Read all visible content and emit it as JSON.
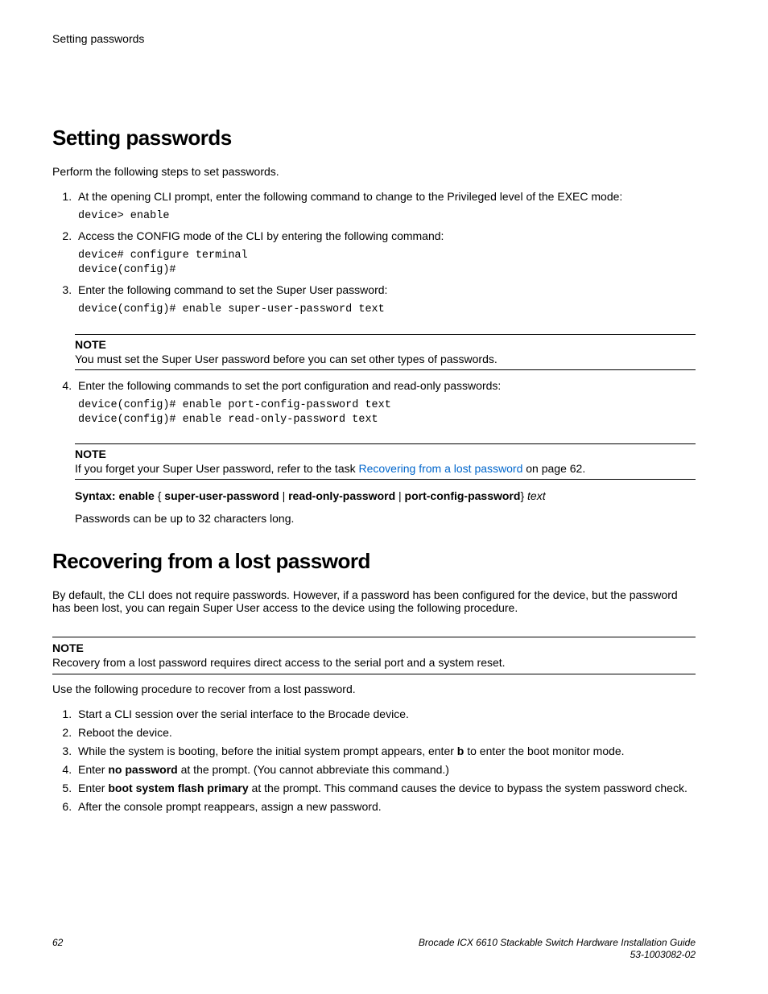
{
  "header_label": "Setting passwords",
  "section1": {
    "title": "Setting passwords",
    "intro": "Perform the following steps to set passwords.",
    "step1": "At the opening CLI prompt, enter the following command to change to the Privileged level of the EXEC mode:",
    "code1": "device> enable",
    "step2": "Access the CONFIG mode of the CLI by entering the following command:",
    "code2": "device# configure terminal\ndevice(config)#",
    "step3": "Enter the following command to set the Super User password:",
    "code3": "device(config)# enable super-user-password text",
    "note1_label": "NOTE",
    "note1_text": "You must set the Super User password before you can set other types of passwords.",
    "step4": "Enter the following commands to set the port configuration and read-only passwords:",
    "code4": "device(config)# enable port-config-password text\ndevice(config)# enable read-only-password text",
    "note2_label": "NOTE",
    "note2_prefix": "If you forget your Super User password, refer to the task ",
    "note2_link": "Recovering from a lost password",
    "note2_suffix": " on page 62.",
    "syntax_prefix": "Syntax: enable",
    "syntax_opt1": "super-user-password",
    "syntax_opt2": "read-only-password",
    "syntax_opt3": "port-config-password",
    "syntax_italic": "text",
    "after_syntax": "Passwords can be up to 32 characters long."
  },
  "section2": {
    "title": "Recovering from a lost password",
    "intro": "By default, the CLI does not require passwords. However, if a password has been configured for the device, but the password has been lost, you can regain Super User access to the device using the following procedure.",
    "note_label": "NOTE",
    "note_text": "Recovery from a lost password requires direct access to the serial port and a system reset.",
    "procedure_intro": "Use the following procedure to recover from a lost password.",
    "step1": "Start a CLI session over the serial interface to the Brocade device.",
    "step2": "Reboot the device.",
    "step3_pre": "While the system is booting, before the initial system prompt appears, enter ",
    "step3_bold": "b",
    "step3_post": " to enter the boot monitor mode.",
    "step4_pre": "Enter ",
    "step4_bold": "no password",
    "step4_post": " at the prompt. (You cannot abbreviate this command.)",
    "step5_pre": "Enter ",
    "step5_bold": "boot system flash primary",
    "step5_post": " at the prompt. This command causes the device to bypass the system password check.",
    "step6": "After the console prompt reappears, assign a new password."
  },
  "footer": {
    "page_number": "62",
    "guide_title": "Brocade ICX 6610 Stackable Switch Hardware Installation Guide",
    "doc_number": "53-1003082-02"
  }
}
